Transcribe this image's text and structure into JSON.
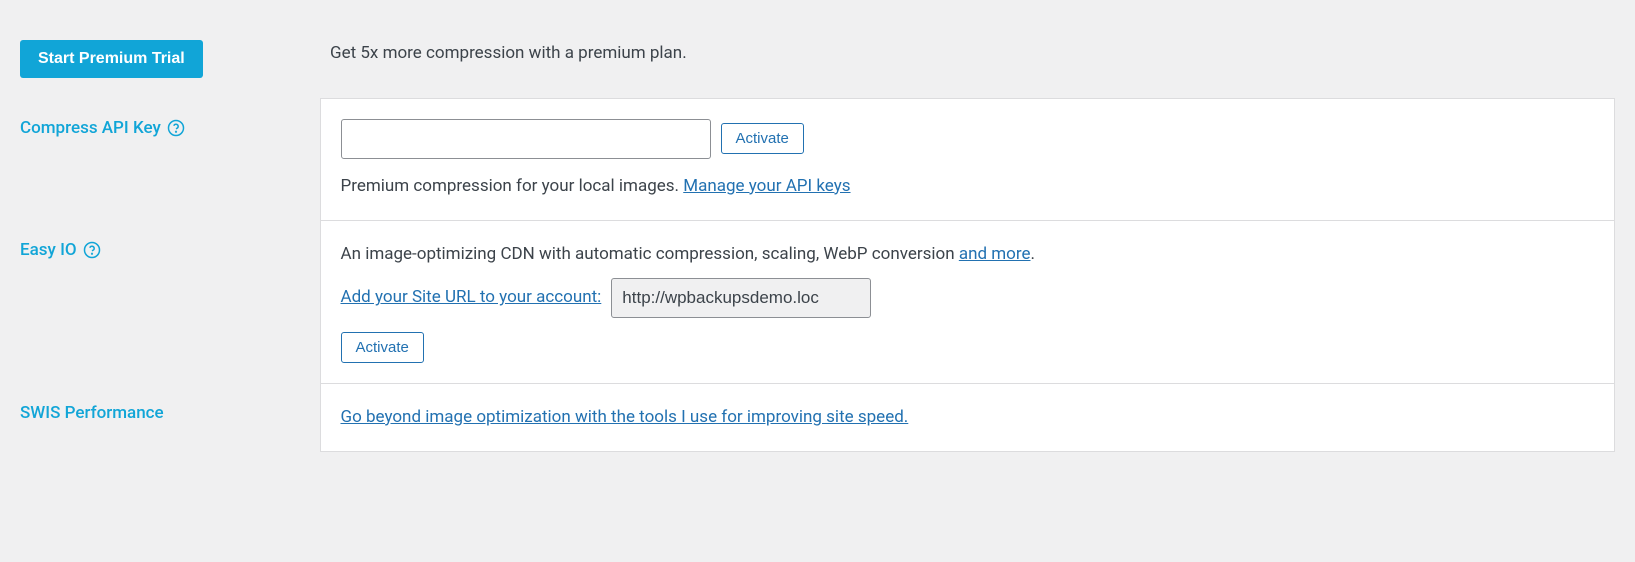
{
  "premium": {
    "button_label": "Start Premium Trial",
    "description": "Get 5x more compression with a premium plan."
  },
  "compress_api": {
    "label": "Compress API Key",
    "activate_label": "Activate",
    "description_prefix": "Premium compression for your local images. ",
    "manage_link": "Manage your API keys",
    "help_title": "Help"
  },
  "easy_io": {
    "label": "Easy IO",
    "description_prefix": "An image-optimizing CDN with automatic compression, scaling, WebP conversion ",
    "and_more_link": "and more",
    "description_suffix": ".",
    "add_site_link": "Add your Site URL to your account:",
    "site_url": "http://wpbackupsdemo.loc",
    "activate_label": "Activate",
    "help_title": "Help"
  },
  "swis": {
    "label": "SWIS Performance",
    "link_text": "Go beyond image optimization with the tools I use for improving site speed."
  }
}
